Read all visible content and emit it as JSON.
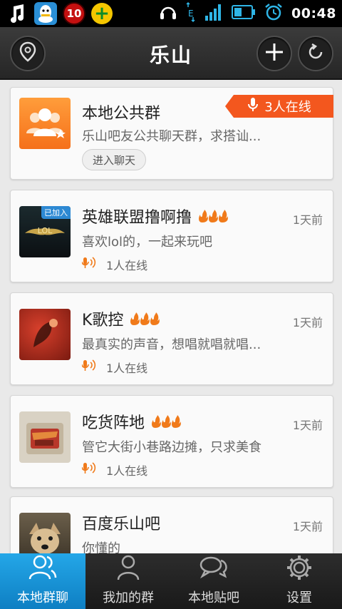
{
  "status_bar": {
    "notification_count": "10",
    "time": "00:48"
  },
  "header": {
    "title": "乐山"
  },
  "groups": [
    {
      "name": "本地公共群",
      "description": "乐山吧友公共聊天群，求搭讪...",
      "online_banner": "3人在线",
      "action_label": "进入聊天"
    },
    {
      "name": "英雄联盟撸啊撸",
      "joined_tag": "已加入",
      "description": "喜欢lol的，一起来玩吧",
      "time": "1天前",
      "online": "1人在线",
      "heat": 3
    },
    {
      "name": "K歌控",
      "description": "最真实的声音，想唱就唱就唱...",
      "time": "1天前",
      "online": "1人在线",
      "heat": 3
    },
    {
      "name": "吃货阵地",
      "description": "管它大街小巷路边摊，只求美食",
      "time": "1天前",
      "online": "1人在线",
      "heat": 3
    },
    {
      "name": "百度乐山吧",
      "description": "你懂的",
      "time": "1天前"
    }
  ],
  "tabs": [
    {
      "label": "本地群聊",
      "icon": "people-icon",
      "active": true
    },
    {
      "label": "我加的群",
      "icon": "person-icon",
      "active": false
    },
    {
      "label": "本地贴吧",
      "icon": "chat-bubbles-icon",
      "active": false
    },
    {
      "label": "设置",
      "icon": "gear-icon",
      "active": false
    }
  ],
  "colors": {
    "accent_blue": "#1a96dc",
    "orange": "#f3571e",
    "flame": "#f07a1a",
    "tabbar": "#222222"
  }
}
